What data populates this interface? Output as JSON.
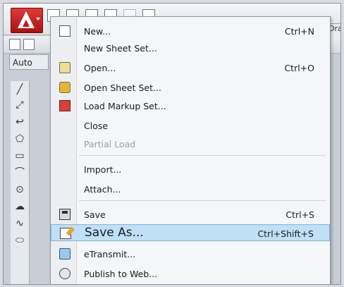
{
  "toolbar": {
    "auto_tab": "Auto",
    "right_tab_fragment": "Dra"
  },
  "menu": {
    "items": [
      {
        "label": "New...",
        "shortcut": "Ctrl+N",
        "icon": "new-document-icon"
      },
      {
        "label": "New Sheet Set...",
        "shortcut": "",
        "icon": ""
      },
      {
        "label": "Open...",
        "shortcut": "Ctrl+O",
        "icon": "open-folder-icon"
      },
      {
        "label": "Open Sheet Set...",
        "shortcut": "",
        "icon": "open-sheet-set-icon"
      },
      {
        "label": "Load Markup Set...",
        "shortcut": "",
        "icon": "load-markup-icon"
      },
      {
        "label": "Close",
        "shortcut": "",
        "icon": ""
      },
      {
        "label": "Partial Load",
        "shortcut": "",
        "icon": "",
        "disabled": true
      },
      {
        "label": "Import...",
        "shortcut": "",
        "icon": ""
      },
      {
        "label": "Attach...",
        "shortcut": "",
        "icon": ""
      },
      {
        "label": "Save",
        "shortcut": "Ctrl+S",
        "icon": "save-icon"
      },
      {
        "label": "Save As...",
        "shortcut": "Ctrl+Shift+S",
        "icon": "save-as-icon",
        "highlighted": true
      },
      {
        "label": "eTransmit...",
        "shortcut": "",
        "icon": "etransmit-icon"
      },
      {
        "label": "Publish to Web...",
        "shortcut": "",
        "icon": "publish-web-icon"
      }
    ]
  },
  "colors": {
    "highlight": "#bfe0f6",
    "app_button": "#c81e1b"
  }
}
